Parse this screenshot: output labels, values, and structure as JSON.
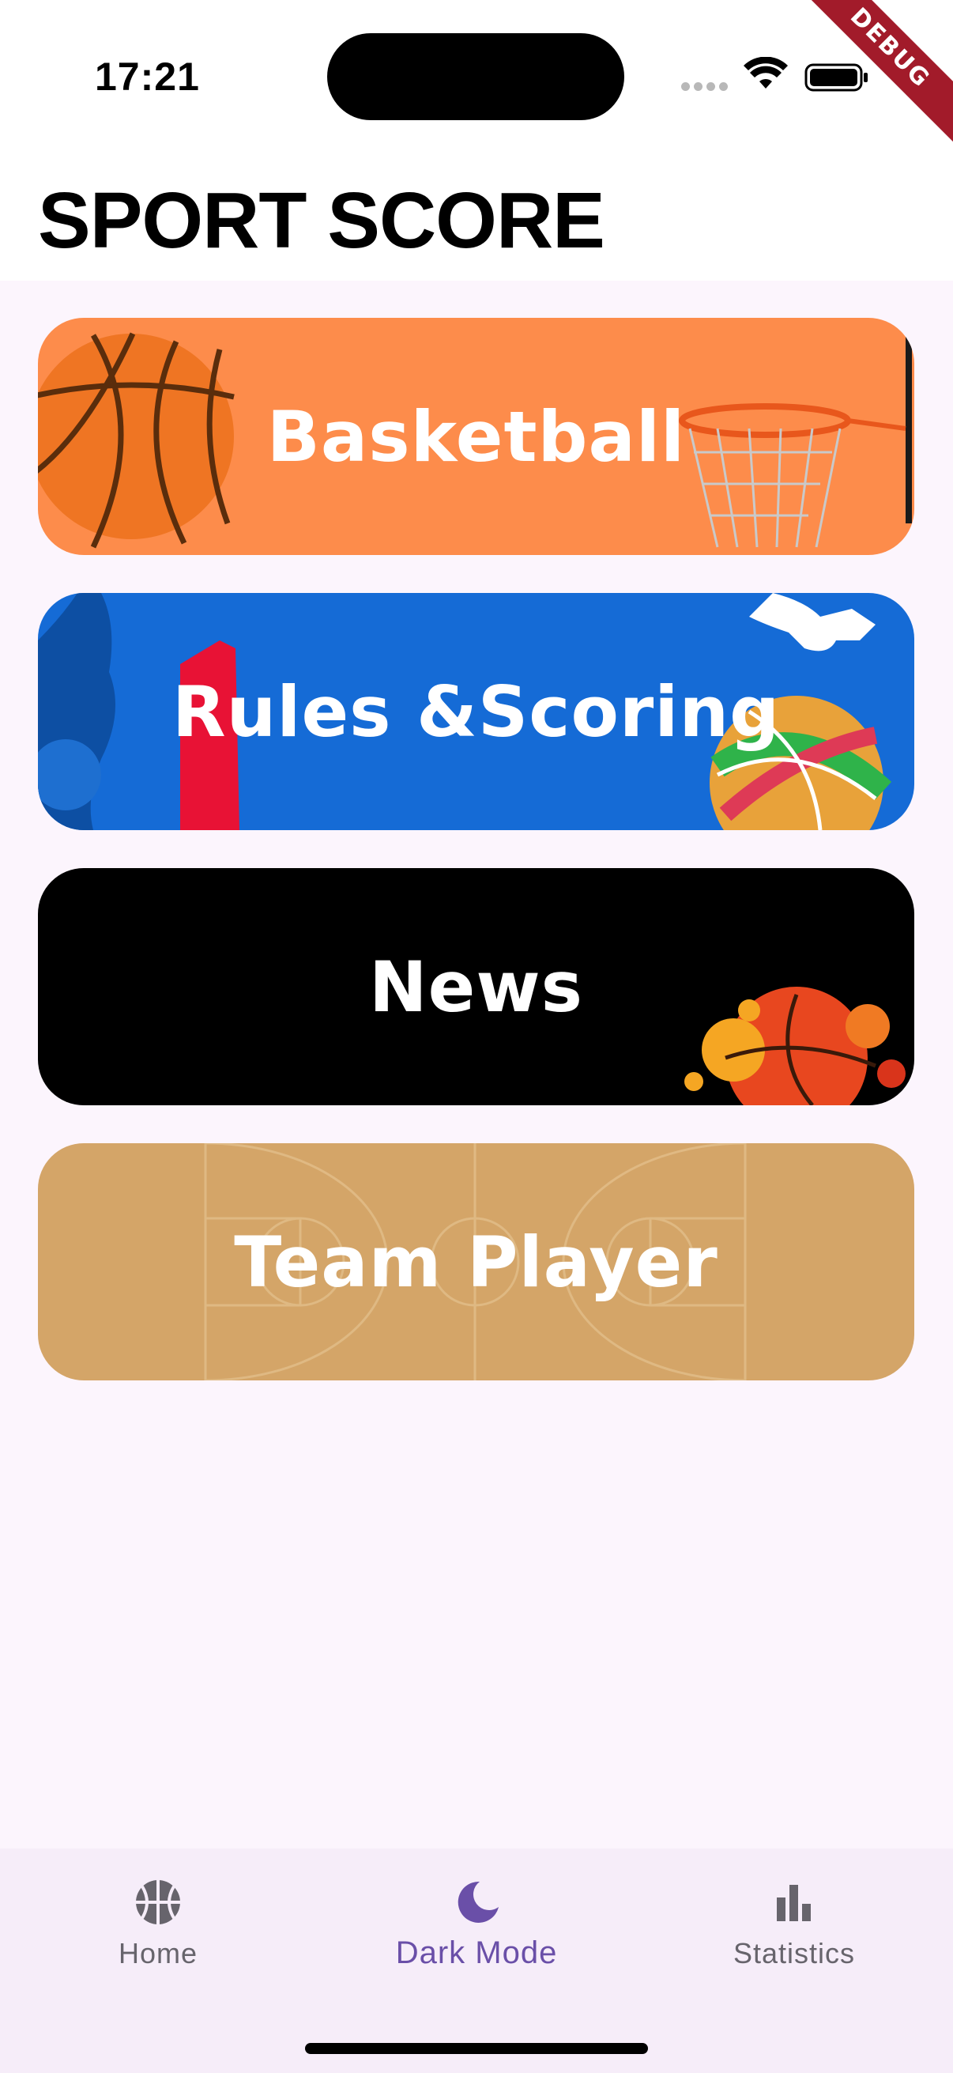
{
  "status_bar": {
    "time": "17:21",
    "debug_banner": "DEBUG"
  },
  "header": {
    "title": "SPORT SCORE"
  },
  "cards": [
    {
      "label": "Basketball",
      "color": "#fd8c4b"
    },
    {
      "label": "Rules &Scoring",
      "color": "#156bd6"
    },
    {
      "label": "News",
      "color": "#000000"
    },
    {
      "label": "Team Player",
      "color": "#d4a568"
    }
  ],
  "bottom_nav": {
    "items": [
      {
        "label": "Home",
        "icon": "basketball-icon",
        "active": false
      },
      {
        "label": "Dark Mode",
        "icon": "moon-icon",
        "active": true
      },
      {
        "label": "Statistics",
        "icon": "bar-chart-icon",
        "active": false
      }
    ],
    "active_color": "#6a4fa8"
  },
  "colors": {
    "background": "#fcf5fd",
    "nav_background": "#f6edf9"
  }
}
